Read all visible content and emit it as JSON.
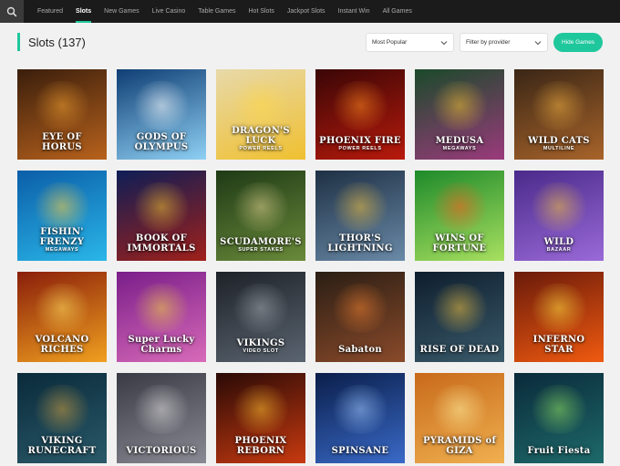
{
  "nav": {
    "search_icon": "search-icon",
    "items": [
      {
        "label": "Featured",
        "active": false
      },
      {
        "label": "Slots",
        "active": true
      },
      {
        "label": "New Games",
        "active": false
      },
      {
        "label": "Live Casino",
        "active": false
      },
      {
        "label": "Table Games",
        "active": false
      },
      {
        "label": "Hot Slots",
        "active": false
      },
      {
        "label": "Jackpot Slots",
        "active": false
      },
      {
        "label": "Instant Win",
        "active": false
      },
      {
        "label": "All Games",
        "active": false
      }
    ]
  },
  "header": {
    "title": "Slots (137)",
    "sort_select": "Most Popular",
    "provider_select": "Filter by provider",
    "hide_games_label": "Hide Games"
  },
  "colors": {
    "accent": "#1fc79c",
    "topbar": "#1b1b1b"
  },
  "games": [
    {
      "name": "EYE OF HORUS",
      "sub": "",
      "c1": "#3a1e0c",
      "c2": "#b8621c",
      "glow": "#f0a030"
    },
    {
      "name": "GODS OF OLYMPUS",
      "sub": "",
      "c1": "#0f3e74",
      "c2": "#8fd0f4",
      "glow": "#ffffff"
    },
    {
      "name": "DRAGON'S LUCK",
      "sub": "POWER REELS",
      "c1": "#e7d9a9",
      "c2": "#f0c030",
      "glow": "#ffd84a"
    },
    {
      "name": "PHOENIX FIRE",
      "sub": "POWER REELS",
      "c1": "#3a0606",
      "c2": "#b81a0c",
      "glow": "#ff8a1e"
    },
    {
      "name": "MEDUSA",
      "sub": "MEGAWAYS",
      "c1": "#1a4a2a",
      "c2": "#9b3a7c",
      "glow": "#f0c030"
    },
    {
      "name": "WILD CATS",
      "sub": "MULTILINE",
      "c1": "#3a2616",
      "c2": "#a8642a",
      "glow": "#f0b040"
    },
    {
      "name": "FISHIN' FRENZY",
      "sub": "MEGAWAYS",
      "c1": "#0b5ea8",
      "c2": "#2ab6e8",
      "glow": "#ffd040"
    },
    {
      "name": "BOOK OF IMMORTALS",
      "sub": "",
      "c1": "#0e1e56",
      "c2": "#a0201a",
      "glow": "#f0c030"
    },
    {
      "name": "SCUDAMORE'S",
      "sub": "SUPER STAKES",
      "c1": "#1e3a16",
      "c2": "#6a8a3a",
      "glow": "#e0d090"
    },
    {
      "name": "THOR'S LIGHTNING",
      "sub": "",
      "c1": "#1e3044",
      "c2": "#6a8aa8",
      "glow": "#f0c040"
    },
    {
      "name": "WINS OF FORTUNE",
      "sub": "",
      "c1": "#1e8a2a",
      "c2": "#a8e060",
      "glow": "#ff5a1e"
    },
    {
      "name": "WILD",
      "sub": "BAZAAR",
      "c1": "#4a2a8a",
      "c2": "#9a6ad8",
      "glow": "#f0c040"
    },
    {
      "name": "VOLCANO RICHES",
      "sub": "",
      "c1": "#8a1e0a",
      "c2": "#f0a020",
      "glow": "#ffe060"
    },
    {
      "name": "Super Lucky Charms",
      "sub": "",
      "c1": "#7a1e8a",
      "c2": "#d86ab8",
      "glow": "#f0d040"
    },
    {
      "name": "VIKINGS",
      "sub": "VIDEO SLOT",
      "c1": "#1e2228",
      "c2": "#5a6470",
      "glow": "#a0a8b0"
    },
    {
      "name": "Sabaton",
      "sub": "",
      "c1": "#2a1e14",
      "c2": "#8a4a2a",
      "glow": "#f08030"
    },
    {
      "name": "RISE OF DEAD",
      "sub": "",
      "c1": "#0e1e2e",
      "c2": "#3a5a6a",
      "glow": "#f0c040"
    },
    {
      "name": "INFERNO STAR",
      "sub": "",
      "c1": "#6a1a0a",
      "c2": "#f05a10",
      "glow": "#ffe040"
    },
    {
      "name": "VIKING RUNECRAFT",
      "sub": "",
      "c1": "#0a2a3a",
      "c2": "#2a5a6a",
      "glow": "#d0a040"
    },
    {
      "name": "VICTORIOUS",
      "sub": "",
      "c1": "#3a3a44",
      "c2": "#8a8a94",
      "glow": "#e0e0e0"
    },
    {
      "name": "PHOENIX REBORN",
      "sub": "",
      "c1": "#2a0a06",
      "c2": "#c83a10",
      "glow": "#ffc030"
    },
    {
      "name": "SPINSANE",
      "sub": "",
      "c1": "#0a1e4a",
      "c2": "#3a6ac8",
      "glow": "#a0c8ff"
    },
    {
      "name": "PYRAMIDS of GIZA",
      "sub": "",
      "c1": "#c86a1a",
      "c2": "#f0b050",
      "glow": "#fff0a0"
    },
    {
      "name": "Fruit Fiesta",
      "sub": "",
      "c1": "#0a2a3a",
      "c2": "#1e6a6a",
      "glow": "#90e060"
    }
  ]
}
